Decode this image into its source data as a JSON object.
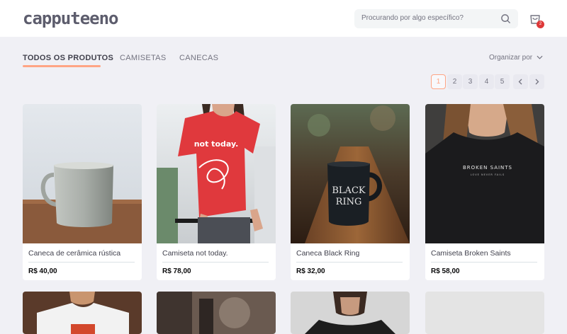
{
  "header": {
    "logo": "capputeeno",
    "search_placeholder": "Procurando por algo específico?",
    "cart_count": "2"
  },
  "tabs": [
    {
      "label": "TODOS OS PRODUTOS",
      "active": true
    },
    {
      "label": "CAMISETAS",
      "active": false
    },
    {
      "label": "CANECAS",
      "active": false
    }
  ],
  "sort": {
    "label": "Organizar por"
  },
  "pagination": {
    "pages": [
      "1",
      "2",
      "3",
      "4",
      "5"
    ],
    "current": "1",
    "prev_icon": "chevron-left-icon",
    "next_icon": "chevron-right-icon"
  },
  "products": [
    {
      "name": "Caneca de cerâmica rústica",
      "price": "R$ 40,00",
      "image": "ceramic-mug"
    },
    {
      "name": "Camiseta not today.",
      "price": "R$ 78,00",
      "image": "red-tshirt"
    },
    {
      "name": "Caneca Black Ring",
      "price": "R$ 32,00",
      "image": "black-mug"
    },
    {
      "name": "Camiseta Broken Saints",
      "price": "R$ 58,00",
      "image": "black-tshirt"
    }
  ],
  "colors": {
    "accent": "#ffa585",
    "background": "#f0f0f5",
    "badge": "#de3838"
  }
}
